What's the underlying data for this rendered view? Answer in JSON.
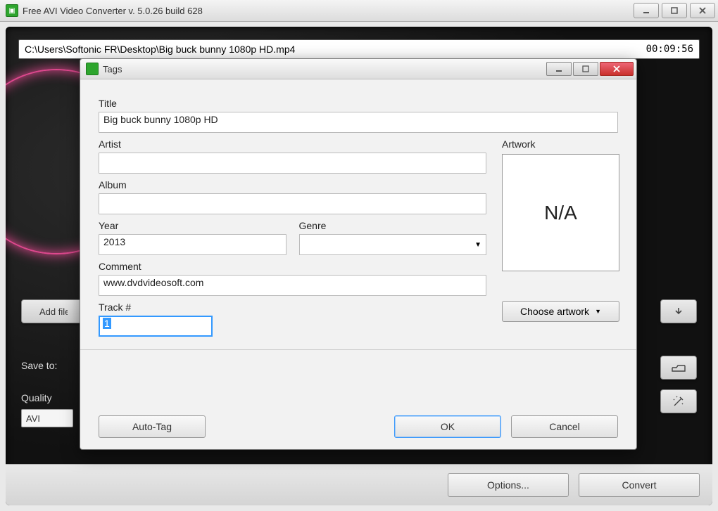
{
  "main": {
    "title": "Free AVI Video Converter  v. 5.0.26 build 628",
    "file_path": "C:\\Users\\Softonic FR\\Desktop\\Big buck bunny 1080p HD.mp4",
    "duration": "00:09:56",
    "add_files": "Add files...",
    "save_to_label": "Save to:",
    "quality_label": "Quality",
    "quality_value": "AVI",
    "options_btn": "Options...",
    "convert_btn": "Convert"
  },
  "dialog": {
    "title": "Tags",
    "labels": {
      "title": "Title",
      "artist": "Artist",
      "album": "Album",
      "year": "Year",
      "genre": "Genre",
      "comment": "Comment",
      "track": "Track #",
      "artwork": "Artwork"
    },
    "values": {
      "title": "Big buck bunny 1080p HD",
      "artist": "",
      "album": "",
      "year": "2013",
      "genre": "",
      "comment": "www.dvdvideosoft.com",
      "track": "1",
      "artwork_placeholder": "N/A"
    },
    "buttons": {
      "choose_artwork": "Choose artwork",
      "auto_tag": "Auto-Tag",
      "ok": "OK",
      "cancel": "Cancel"
    }
  }
}
